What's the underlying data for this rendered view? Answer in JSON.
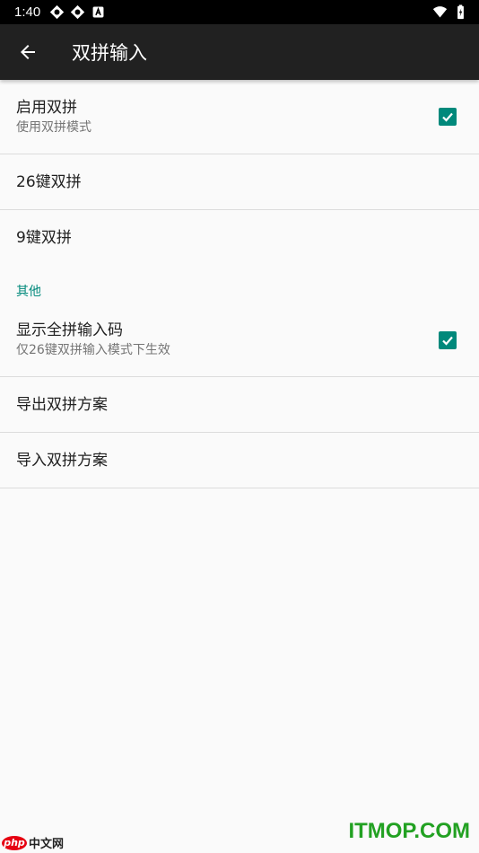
{
  "status_bar": {
    "time": "1:40",
    "icons_left": [
      "settings-notification-icon",
      "settings-notification-icon",
      "a-notification-icon"
    ],
    "icons_right": [
      "wifi-icon",
      "battery-icon"
    ]
  },
  "app_bar": {
    "back_icon": "arrow-back-icon",
    "title": "双拼输入"
  },
  "preferences": [
    {
      "title": "启用双拼",
      "summary": "使用双拼模式",
      "checked": true
    },
    {
      "title": "26键双拼"
    },
    {
      "title": "9键双拼"
    }
  ],
  "section_other": {
    "header": "其他",
    "items": [
      {
        "title": "显示全拼输入码",
        "summary": "仅26键双拼输入模式下生效",
        "checked": true
      },
      {
        "title": "导出双拼方案"
      },
      {
        "title": "导入双拼方案"
      }
    ]
  },
  "watermarks": {
    "left_logo": "php",
    "left_text": "中文网",
    "right_text": "ITMOP.COM"
  },
  "colors": {
    "accent": "#00897b",
    "app_bar": "#212121",
    "status_bar": "#000000",
    "background": "#fafafa"
  }
}
